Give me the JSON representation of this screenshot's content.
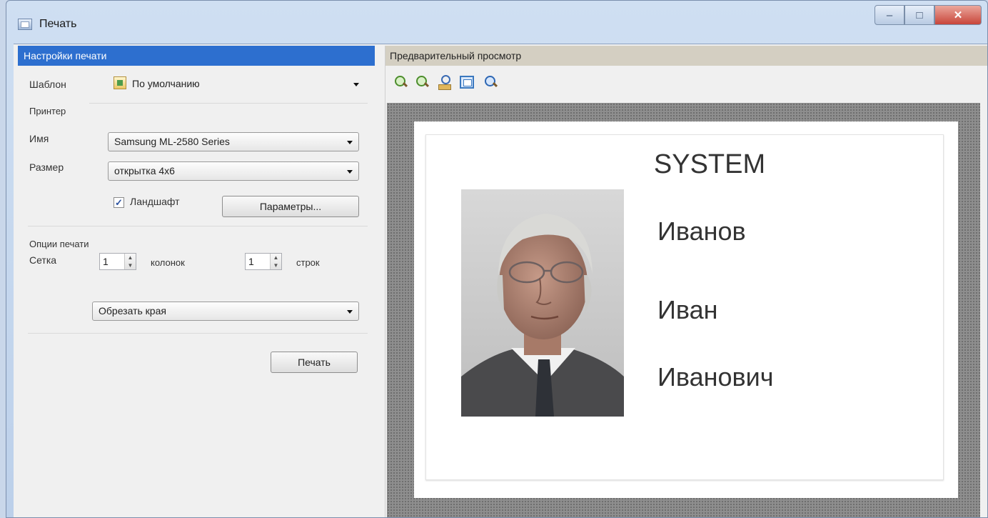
{
  "window": {
    "title": "Печать"
  },
  "settings": {
    "header": "Настройки печати",
    "template_label": "Шаблон",
    "template_value": "По умолчанию",
    "printer_group": "Принтер",
    "name_label": "Имя",
    "name_value": "Samsung ML-2580 Series",
    "size_label": "Размер",
    "size_value": "открытка 4х6",
    "landscape_label": "Ландшафт",
    "landscape_checked": true,
    "params_button": "Параметры...",
    "options_group": "Опции печати",
    "grid_label": "Сетка",
    "columns_value": "1",
    "columns_label": "колонок",
    "rows_value": "1",
    "rows_label": "строк",
    "crop_value": "Обрезать края",
    "print_button": "Печать"
  },
  "preview": {
    "header": "Предварительный просмотр",
    "toolbar": [
      "zoom-in-icon",
      "zoom-out-icon",
      "find-icon",
      "fit-page-icon",
      "zoom-icon"
    ],
    "card": {
      "company": "SYSTEM",
      "surname": "Иванов",
      "first_name": "Иван",
      "patronymic": "Иванович"
    }
  },
  "colors": {
    "accent_header": "#2d6fcf",
    "preview_header": "#d4cfc2"
  }
}
